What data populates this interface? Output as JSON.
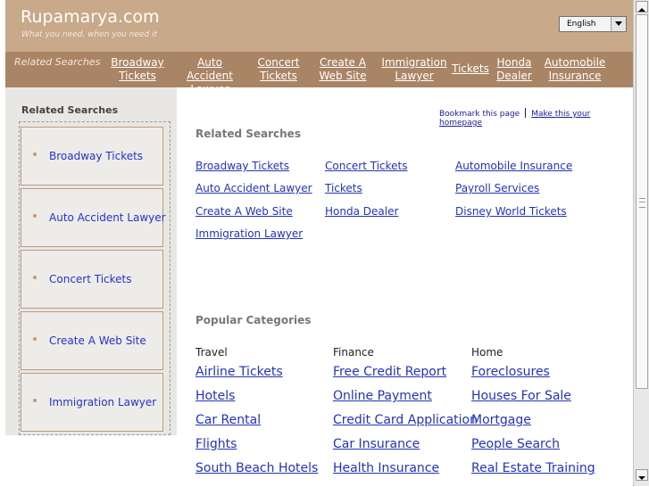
{
  "header": {
    "site_name": "Rupamarya.com",
    "tagline": "What you need, when you need it",
    "language": "English"
  },
  "nav": {
    "related_label": "Related Searches",
    "links": [
      "Broadway\nTickets",
      "Auto Accident\nLawyer",
      "Concert\nTickets",
      "Create A\nWeb Site",
      "Immigration\nLawyer",
      "Tickets",
      "Honda\nDealer",
      "Automobile\nInsurance"
    ]
  },
  "sidebar": {
    "title": "Related Searches",
    "items": [
      "Broadway Tickets",
      "Auto Accident Lawyer",
      "Concert Tickets",
      "Create A Web Site",
      "Immigration Lawyer"
    ]
  },
  "main": {
    "bookmark": "Bookmark this page",
    "homepage": "Make this your homepage",
    "related_title": "Related Searches",
    "related_links": {
      "col1": [
        "Broadway Tickets",
        "Auto Accident Lawyer",
        "Create A Web Site",
        "Immigration Lawyer"
      ],
      "col2": [
        "Concert Tickets",
        "Tickets",
        "Honda Dealer"
      ],
      "col3": [
        "Automobile Insurance",
        "Payroll Services",
        "Disney World Tickets"
      ]
    },
    "popular_title": "Popular Categories",
    "categories": [
      {
        "name": "Travel",
        "links": [
          "Airline Tickets",
          "Hotels",
          "Car Rental",
          "Flights",
          "South Beach Hotels"
        ]
      },
      {
        "name": "Finance",
        "links": [
          "Free Credit Report",
          "Online Payment",
          "Credit Card Application",
          "Car Insurance",
          "Health Insurance"
        ]
      },
      {
        "name": "Home",
        "links": [
          "Foreclosures",
          "Houses For Sale",
          "Mortgage",
          "People Search",
          "Real Estate Training"
        ]
      }
    ]
  },
  "icons": {
    "dropdown": "chevron-down-icon",
    "scroll_up": "arrow-up-icon",
    "scroll_down": "arrow-down-icon"
  },
  "colors": {
    "header_bg": "#c8a98a",
    "nav_bg": "#a98565",
    "link": "#2233bb"
  }
}
